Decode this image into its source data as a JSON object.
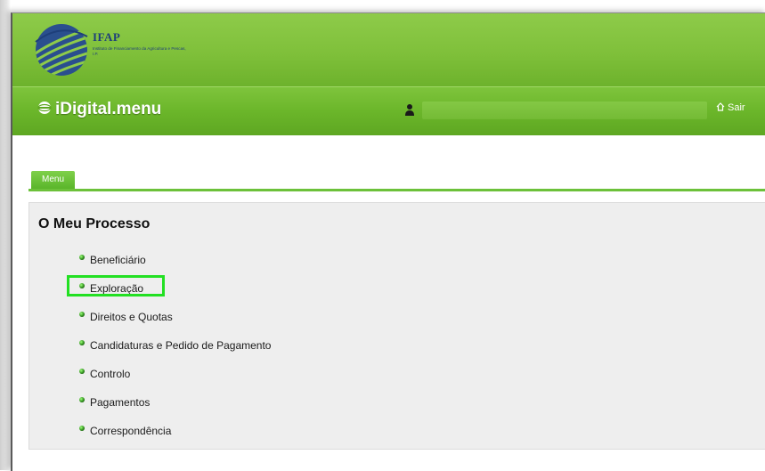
{
  "logo": {
    "title": "IFAP",
    "subtitle": "Instituto de Financiamento da Agricultura e Pescas, I.P."
  },
  "header": {
    "app_title": "iDigital.menu",
    "logout_label": "Sair"
  },
  "tabs": [
    {
      "label": "Menu",
      "active": true
    }
  ],
  "panel": {
    "title": "O Meu Processo",
    "items": [
      {
        "label": "Beneficiário",
        "highlighted": false
      },
      {
        "label": "Exploração",
        "highlighted": true
      },
      {
        "label": "Direitos e Quotas",
        "highlighted": false
      },
      {
        "label": "Candidaturas e Pedido de Pagamento",
        "highlighted": false
      },
      {
        "label": "Controlo",
        "highlighted": false
      },
      {
        "label": "Pagamentos",
        "highlighted": false
      },
      {
        "label": "Correspondência",
        "highlighted": false
      }
    ]
  },
  "colors": {
    "header_green": "#7fc03a",
    "menubar_green": "#6bb62a",
    "highlight_green": "#22e022",
    "logo_blue": "#1e3f7a"
  },
  "icons": {
    "app": "globe-icon",
    "user": "user-icon",
    "logout": "home-icon",
    "bullet": "bullet-icon"
  }
}
